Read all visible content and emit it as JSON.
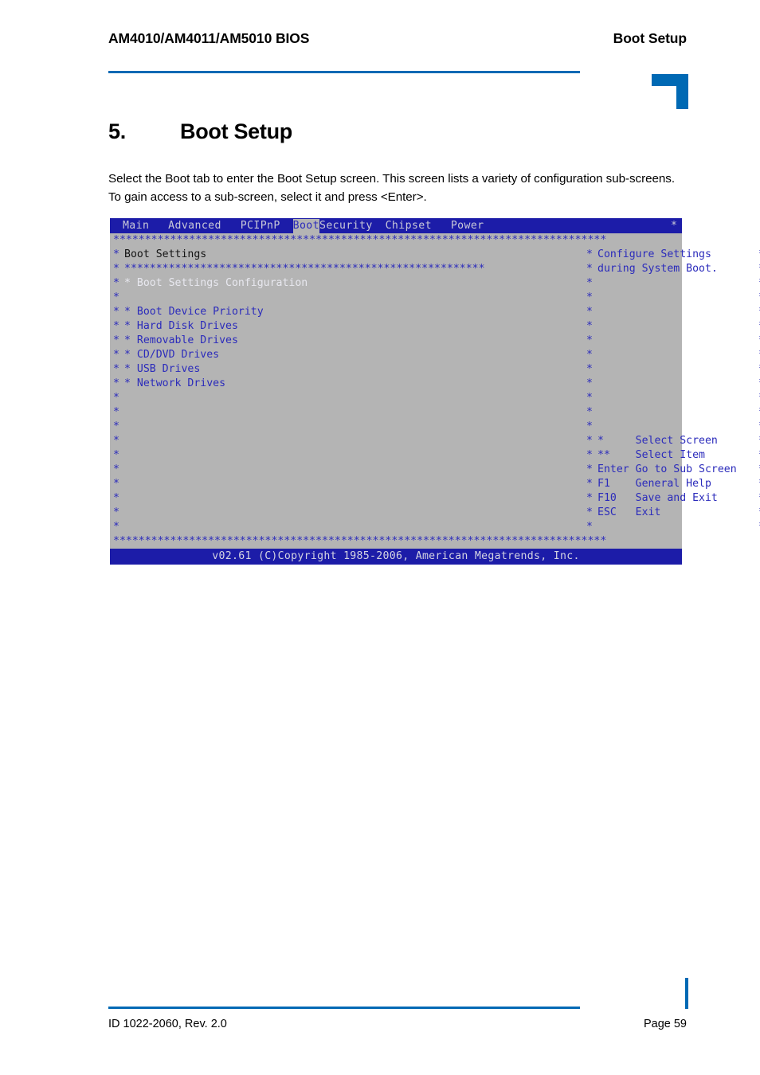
{
  "document": {
    "header": {
      "left_title": "AM4010/AM4011/AM5010 BIOS",
      "right_title": "Boot Setup"
    },
    "section": {
      "number": "5.",
      "title": "Boot Setup"
    },
    "paragraph": "Select the Boot tab to enter the Boot Setup screen. This screen lists a variety of configuration sub-screens. To gain access to a sub-screen, select it and press <Enter>.",
    "footer": {
      "left": "ID 1022-2060, Rev. 2.0",
      "right": "Page 59"
    },
    "accent_color": "#0069b4"
  },
  "bios": {
    "colors": {
      "screen_background": "#b4b4b4",
      "menu_background": "#1c1ca8",
      "text_blue": "#2b2bbb",
      "text_white": "#e8e8ef",
      "text_black": "#141414",
      "active_tab_background": "#b4b4b4"
    },
    "menu_tabs": [
      {
        "label": "Main",
        "active": false
      },
      {
        "label": "Advanced",
        "active": false
      },
      {
        "label": "PCIPnP",
        "active": false
      },
      {
        "label": "Boot",
        "active": true
      },
      {
        "label": "Security",
        "active": false
      },
      {
        "label": "Chipset",
        "active": false
      },
      {
        "label": "Power",
        "active": false
      }
    ],
    "menu_edge_star": "*",
    "top_rule": "******************************************************************************",
    "bottom_rule": "******************************************************************************",
    "inner_rule": "*********************************************************",
    "panel_title": "Boot Settings",
    "left_items": [
      {
        "bullet": "*",
        "label": "Boot Settings Configuration",
        "selected": true
      },
      {
        "bullet": "",
        "label": "",
        "selected": false
      },
      {
        "bullet": "*",
        "label": "Boot Device Priority",
        "selected": false
      },
      {
        "bullet": "*",
        "label": "Hard Disk Drives",
        "selected": false
      },
      {
        "bullet": "*",
        "label": "Removable Drives",
        "selected": false
      },
      {
        "bullet": "*",
        "label": "CD/DVD Drives",
        "selected": false
      },
      {
        "bullet": "*",
        "label": "USB Drives",
        "selected": false
      },
      {
        "bullet": "*",
        "label": "Network Drives",
        "selected": false
      }
    ],
    "help_text": [
      "Configure Settings",
      "during System Boot."
    ],
    "legend": [
      {
        "key": "*",
        "action": "Select Screen"
      },
      {
        "key": "**",
        "action": "Select Item"
      },
      {
        "key": "Enter",
        "action": "Go to Sub Screen"
      },
      {
        "key": "F1",
        "action": "General Help"
      },
      {
        "key": "F10",
        "action": "Save and Exit"
      },
      {
        "key": "ESC",
        "action": "Exit"
      }
    ],
    "copyright": "v02.61 (C)Copyright 1985-2006, American Megatrends, Inc."
  }
}
